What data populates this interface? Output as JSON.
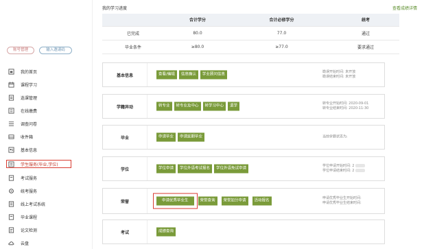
{
  "sidebar": {
    "account_mgmt": "账号管理",
    "input_invite": "输入邀请码",
    "items": [
      {
        "label": "我的首页",
        "icon": "home-icon"
      },
      {
        "label": "课程学习",
        "icon": "calendar-icon"
      },
      {
        "label": "选课管理",
        "icon": "clipboard-icon"
      },
      {
        "label": "在线缴费",
        "icon": "payment-icon"
      },
      {
        "label": "调查问卷",
        "icon": "list-icon"
      },
      {
        "label": "收件箱",
        "icon": "inbox-icon"
      },
      {
        "label": "基本信息",
        "icon": "profile-icon"
      },
      {
        "label": "学生服务(毕业,学位)",
        "icon": "service-icon"
      },
      {
        "label": "考试服务",
        "icon": "exam-icon"
      },
      {
        "label": "统考服务",
        "icon": "gear-icon"
      },
      {
        "label": "线上考试系统",
        "icon": "document-icon"
      },
      {
        "label": "毕业课程",
        "icon": "book-icon"
      },
      {
        "label": "论文检测",
        "icon": "paper-icon"
      },
      {
        "label": "云盘",
        "icon": "cloud-icon"
      }
    ]
  },
  "progress": {
    "title": "我的学习进度",
    "link": "查看成绩详情",
    "headers": [
      "",
      "合计学分",
      "合计必修学分",
      "统考"
    ],
    "rows": [
      [
        "已完成",
        "80.0",
        "77.0",
        "通过"
      ],
      [
        "毕业条件",
        "≥80.0",
        "≥77.0",
        "要求通过"
      ]
    ]
  },
  "sections": [
    {
      "title": "基本信息",
      "buttons": [
        "查看/编辑",
        "信息确认",
        "学业顾问信息"
      ],
      "info": [
        "勘误开始时间: 未开放",
        "勘误结束时间: 未开放"
      ]
    },
    {
      "title": "学籍异动",
      "buttons": [
        "转专业",
        "转专业及中心",
        "转学习中心",
        "退学"
      ],
      "info": [
        "转专业开始时间: 2020-09-01",
        "转专业结束时间: 2020-11-30"
      ]
    },
    {
      "title": "毕业",
      "buttons": [
        "申请毕业",
        "申请延期毕业"
      ],
      "info": [
        "当前学籍状态为:"
      ]
    },
    {
      "title": "学位",
      "buttons": [
        "学位申请",
        "学位外语考试报名",
        "学位外语免试申请"
      ],
      "info": [
        "学位申请开始时间: 2",
        "学位申请结束时间: 2"
      ]
    },
    {
      "title": "荣誉",
      "buttons": [
        "申请优秀毕业生",
        "荣誉查询",
        "荣誉加分申请",
        "活动报名"
      ],
      "info": [
        "申请优秀毕业生开始时间:",
        "申请优秀毕业生结束时间:"
      ]
    },
    {
      "title": "考试",
      "buttons": [
        "成绩查询"
      ],
      "info": []
    }
  ],
  "colors": {
    "button_green": "#7a9b3a",
    "highlight_red": "#d83a2f",
    "link_green": "#5a8d2a"
  }
}
